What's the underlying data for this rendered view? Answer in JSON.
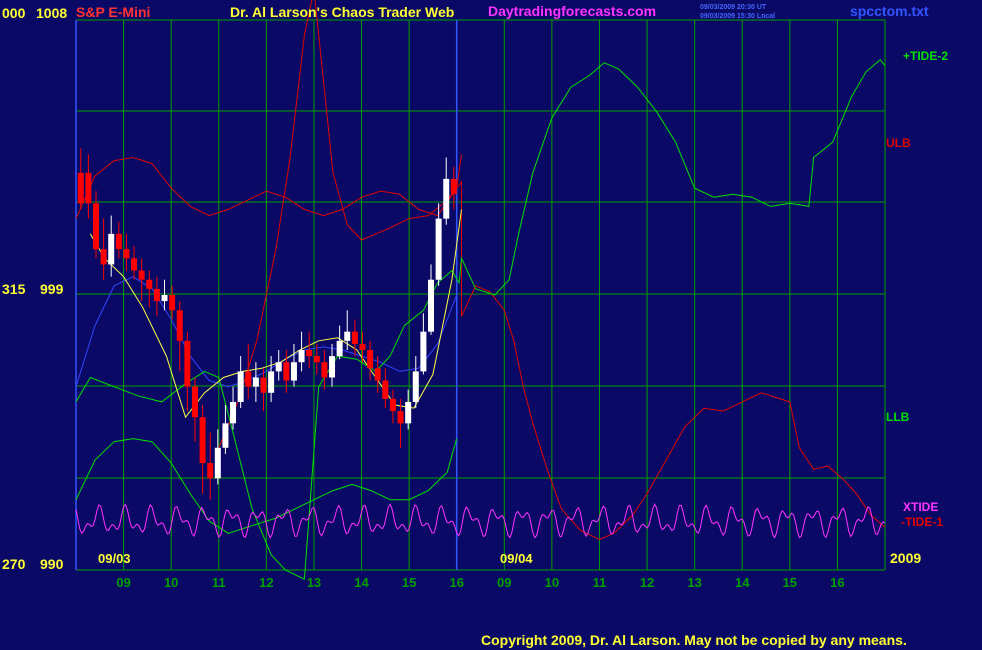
{
  "header": {
    "left_code": "000",
    "left_price": "1008",
    "symbol": "S&P E-Mini",
    "title": "Dr. Al Larson's Chaos Trader Web",
    "website": "Daytradingforecasts.com",
    "stamp_ut": "09/03/2009 20:30 UT",
    "stamp_local": "09/03/2009 15:30 Local",
    "file": "spcctom.txt"
  },
  "footer": {
    "copyright": "Copyright 2009, Dr. Al Larson. May not be copied by any means.",
    "date_left": "09/03",
    "date_mid": "09/04",
    "year": "2009"
  },
  "colors": {
    "background": "#0a0a66",
    "grid": "#00a000",
    "divider": "#3355ff",
    "price_up": "#ffffff",
    "price_down": "#ff0000",
    "tide2": "#00e000",
    "ulb": "#e00000",
    "llb": "#00e000",
    "xtide": "#ff33ff",
    "tide1": "#e00000",
    "avg": "#ffff44",
    "cycle": "#3344ff",
    "title_yellow": "#ffff33",
    "title_red": "#ff3333",
    "title_magenta": "#ff33ff"
  },
  "chart_data": {
    "type": "line",
    "title": "Dr. Al Larson's Chaos Trader Web",
    "symbol": "S&P E-Mini",
    "ylim": [
      990,
      1008
    ],
    "y_ticks": [
      {
        "code": "000",
        "price": "1008",
        "value": 1008
      },
      {
        "code": "315",
        "price": "999",
        "value": 999
      },
      {
        "code": "270",
        "price": "990",
        "value": 990
      }
    ],
    "x_ticks": [
      "09",
      "10",
      "11",
      "12",
      "13",
      "14",
      "15",
      "16",
      "09",
      "10",
      "11",
      "12",
      "13",
      "14",
      "15",
      "16"
    ],
    "x_dates": [
      "09/03",
      "09/04"
    ],
    "series_labels": [
      {
        "name": "+TIDE-2",
        "color": "#00e000"
      },
      {
        "name": "ULB",
        "color": "#e00000"
      },
      {
        "name": "LLB",
        "color": "#00e000"
      },
      {
        "name": "XTIDE",
        "color": "#ff33ff"
      },
      {
        "name": "-TIDE-1",
        "color": "#e00000"
      }
    ],
    "price_bars_start_hour": 8.1,
    "price_bars": [
      [
        1003,
        1002,
        1003.8,
        1001.8
      ],
      [
        1003,
        1002,
        1003.6,
        1001.5
      ],
      [
        1002,
        1000.5,
        1002.4,
        1000.2
      ],
      [
        1000.5,
        1000,
        1001.5,
        999.5
      ],
      [
        1000,
        1001,
        1001.6,
        999.6
      ],
      [
        1001,
        1000.5,
        1001.4,
        1000.2
      ],
      [
        1000.5,
        1000.2,
        1001,
        999.8
      ],
      [
        1000.2,
        999.8,
        1000.6,
        999.5
      ],
      [
        999.8,
        999.5,
        1000.2,
        998.8
      ],
      [
        999.5,
        999.2,
        999.8,
        998.6
      ],
      [
        999.2,
        998.8,
        999.6,
        998.3
      ],
      [
        998.8,
        999,
        999.5,
        998.5
      ],
      [
        999,
        998.5,
        999.3,
        998.2
      ],
      [
        998.5,
        997.5,
        998.8,
        996.5
      ],
      [
        997.5,
        996,
        997.8,
        995.2
      ],
      [
        996,
        995,
        996.3,
        994.2
      ],
      [
        995,
        993.5,
        995.4,
        992.5
      ],
      [
        993.5,
        993,
        994.5,
        992.3
      ],
      [
        993,
        994,
        994.6,
        992.8
      ],
      [
        994,
        994.8,
        995.4,
        993.8
      ],
      [
        994.8,
        995.5,
        996,
        994.6
      ],
      [
        995.5,
        996.5,
        997,
        995.3
      ],
      [
        996.5,
        996,
        997.4,
        995.6
      ],
      [
        996,
        996.3,
        996.8,
        995.5
      ],
      [
        996.3,
        995.8,
        996.6,
        995.2
      ],
      [
        995.8,
        996.5,
        997,
        995.5
      ],
      [
        996.5,
        996.8,
        997.2,
        996.2
      ],
      [
        996.8,
        996.2,
        997.2,
        995.8
      ],
      [
        996.2,
        996.8,
        997.4,
        996
      ],
      [
        996.8,
        997.2,
        997.8,
        996.5
      ],
      [
        997.2,
        997,
        997.8,
        996.6
      ],
      [
        997,
        996.8,
        997.4,
        996.4
      ],
      [
        996.8,
        996.3,
        997.2,
        995.9
      ],
      [
        996.3,
        997,
        997.4,
        996
      ],
      [
        997,
        997.5,
        998,
        996.9
      ],
      [
        997.5,
        997.8,
        998.5,
        997.2
      ],
      [
        997.8,
        997.4,
        998.2,
        997
      ],
      [
        997.4,
        997.2,
        997.8,
        996.8
      ],
      [
        997.2,
        996.6,
        997.5,
        996.2
      ],
      [
        996.6,
        996.2,
        997,
        995.8
      ],
      [
        996.2,
        995.6,
        996.6,
        995.3
      ],
      [
        995.6,
        995.2,
        995.9,
        994.8
      ],
      [
        995.2,
        994.8,
        995.6,
        994
      ],
      [
        994.8,
        995.5,
        995.9,
        994.6
      ],
      [
        995.5,
        996.5,
        997,
        995.3
      ],
      [
        996.5,
        997.8,
        998.4,
        996.4
      ],
      [
        997.8,
        999.5,
        1000,
        997.7
      ],
      [
        999.5,
        1001.5,
        1002,
        999.3
      ],
      [
        1001.5,
        1002.8,
        1003.5,
        1001.3
      ],
      [
        1002.8,
        1002.3,
        1003.2,
        1001.8
      ]
    ],
    "moving_average": [
      [
        8.3,
        1001
      ],
      [
        8.6,
        1000.2
      ],
      [
        9.0,
        999.6
      ],
      [
        9.4,
        998.6
      ],
      [
        9.9,
        997
      ],
      [
        10.3,
        995
      ],
      [
        10.7,
        995.8
      ],
      [
        11.1,
        996.3
      ],
      [
        11.5,
        996.5
      ],
      [
        11.9,
        996.6
      ],
      [
        12.3,
        996.8
      ],
      [
        12.7,
        997.2
      ],
      [
        13.1,
        997.5
      ],
      [
        13.5,
        997.6
      ],
      [
        13.9,
        997.2
      ],
      [
        14.3,
        996.3
      ],
      [
        14.7,
        995.4
      ],
      [
        15.1,
        995.3
      ],
      [
        15.5,
        996.4
      ],
      [
        15.9,
        999.5
      ],
      [
        16.1,
        1001.8
      ]
    ],
    "cycle": [
      [
        8.0,
        996
      ],
      [
        8.4,
        998
      ],
      [
        8.8,
        999.3
      ],
      [
        9.2,
        999.6
      ],
      [
        9.6,
        999.2
      ],
      [
        10.0,
        998.2
      ],
      [
        10.4,
        997
      ],
      [
        10.8,
        996.2
      ],
      [
        11.2,
        996
      ],
      [
        11.6,
        996.2
      ],
      [
        12.0,
        996.5
      ],
      [
        12.4,
        996.9
      ],
      [
        12.8,
        997.2
      ],
      [
        13.2,
        997.3
      ],
      [
        13.6,
        997.2
      ],
      [
        14.0,
        997
      ],
      [
        14.4,
        996.8
      ],
      [
        14.8,
        996.5
      ],
      [
        15.2,
        996.6
      ],
      [
        15.6,
        997.4
      ],
      [
        16.0,
        999
      ]
    ],
    "ulb": [
      [
        8.0,
        1001.5
      ],
      [
        8.4,
        1002.9
      ],
      [
        8.8,
        1003.4
      ],
      [
        9.2,
        1003.5
      ],
      [
        9.6,
        1003.3
      ],
      [
        10.0,
        1002.5
      ],
      [
        10.4,
        1001.9
      ],
      [
        10.8,
        1001.6
      ],
      [
        11.2,
        1001.8
      ],
      [
        11.6,
        1002.1
      ],
      [
        12.0,
        1002.4
      ],
      [
        12.4,
        1002.2
      ],
      [
        12.8,
        1001.8
      ],
      [
        13.2,
        1001.6
      ],
      [
        13.6,
        1001.8
      ],
      [
        14.0,
        1002.2
      ],
      [
        14.4,
        1002.4
      ],
      [
        14.8,
        1002.3
      ],
      [
        15.2,
        1001.8
      ],
      [
        15.6,
        1001.6
      ],
      [
        16.0,
        1002.5
      ],
      [
        16.1,
        1003.6
      ]
    ],
    "llb": [
      [
        8.0,
        992.3
      ],
      [
        8.4,
        993.6
      ],
      [
        8.8,
        994.2
      ],
      [
        9.2,
        994.3
      ],
      [
        9.6,
        994.2
      ],
      [
        10.0,
        993.5
      ],
      [
        10.4,
        992.5
      ],
      [
        10.8,
        991.6
      ],
      [
        11.2,
        991.2
      ],
      [
        11.6,
        991.4
      ],
      [
        11.8,
        991.5
      ],
      [
        12.2,
        991.7
      ],
      [
        12.6,
        992
      ],
      [
        13.0,
        992.3
      ],
      [
        13.4,
        992.6
      ],
      [
        13.8,
        992.8
      ],
      [
        14.2,
        992.6
      ],
      [
        14.6,
        992.3
      ],
      [
        15.0,
        992.3
      ],
      [
        15.4,
        992.6
      ],
      [
        15.8,
        993.2
      ],
      [
        16.0,
        994.3
      ]
    ],
    "tide2": [
      [
        8.0,
        995.5
      ],
      [
        8.3,
        996.3
      ],
      [
        8.8,
        996
      ],
      [
        9.3,
        995.7
      ],
      [
        9.8,
        995.5
      ],
      [
        10.3,
        996.1
      ],
      [
        10.7,
        996.5
      ],
      [
        11.0,
        996.3
      ],
      [
        11.3,
        994.5
      ],
      [
        11.7,
        992
      ],
      [
        12.1,
        990.5
      ],
      [
        12.4,
        990
      ],
      [
        12.8,
        989.7
      ],
      [
        13.1,
        996
      ],
      [
        13.5,
        997
      ],
      [
        13.9,
        996.9
      ],
      [
        14.3,
        996.5
      ],
      [
        14.6,
        997
      ],
      [
        14.9,
        998
      ],
      [
        15.3,
        998.5
      ],
      [
        15.6,
        999.4
      ],
      [
        15.9,
        999.8
      ],
      [
        16.05,
        999.4
      ],
      [
        16.1,
        1000.2
      ],
      [
        16.4,
        999.2
      ],
      [
        16.8,
        999
      ],
      [
        17.1,
        999.5
      ],
      [
        17.3,
        1001
      ],
      [
        17.6,
        1003
      ],
      [
        18.0,
        1004.8
      ],
      [
        18.4,
        1005.8
      ],
      [
        18.8,
        1006.2
      ],
      [
        19.1,
        1006.6
      ],
      [
        19.4,
        1006.4
      ],
      [
        19.8,
        1005.8
      ],
      [
        20.2,
        1005
      ],
      [
        20.6,
        1004
      ],
      [
        21.0,
        1002.5
      ],
      [
        21.4,
        1002.2
      ],
      [
        21.8,
        1002.3
      ],
      [
        22.2,
        1002.2
      ],
      [
        22.6,
        1001.9
      ],
      [
        23.0,
        1002
      ],
      [
        23.4,
        1001.9
      ],
      [
        23.5,
        1003.5
      ],
      [
        23.9,
        1004
      ],
      [
        24.3,
        1005.5
      ],
      [
        24.6,
        1006.3
      ],
      [
        24.9,
        1006.7
      ],
      [
        25.0,
        1006.5
      ]
    ],
    "tide1": [
      [
        11.0,
        994
      ],
      [
        11.4,
        995.5
      ],
      [
        11.8,
        997.5
      ],
      [
        12.2,
        1000.5
      ],
      [
        12.5,
        1003.5
      ],
      [
        12.8,
        1007.5
      ],
      [
        13.0,
        1009
      ],
      [
        13.2,
        1006
      ],
      [
        13.4,
        1003
      ],
      [
        13.7,
        1001.3
      ],
      [
        14.0,
        1000.8
      ],
      [
        14.3,
        1001
      ],
      [
        14.6,
        1001.2
      ],
      [
        15.0,
        1001.5
      ],
      [
        15.4,
        1001.6
      ],
      [
        15.8,
        1002.1
      ],
      [
        16.1,
        1002.7
      ],
      [
        16.1,
        998.3
      ],
      [
        16.4,
        999.3
      ],
      [
        16.7,
        999.1
      ],
      [
        17.0,
        998.5
      ],
      [
        17.2,
        997.5
      ],
      [
        17.4,
        996
      ],
      [
        17.6,
        994.8
      ],
      [
        17.9,
        993.3
      ],
      [
        18.2,
        992
      ],
      [
        18.6,
        991.3
      ],
      [
        19.0,
        991
      ],
      [
        19.3,
        991.2
      ],
      [
        19.7,
        991.8
      ],
      [
        20.0,
        992.5
      ],
      [
        20.4,
        993.6
      ],
      [
        20.8,
        994.7
      ],
      [
        21.2,
        995.3
      ],
      [
        21.6,
        995.2
      ],
      [
        22.0,
        995.5
      ],
      [
        22.4,
        995.8
      ],
      [
        22.8,
        995.6
      ],
      [
        23.0,
        995.5
      ],
      [
        23.2,
        994
      ],
      [
        23.5,
        993.3
      ],
      [
        23.8,
        993.4
      ],
      [
        24.1,
        993
      ],
      [
        24.4,
        992.5
      ],
      [
        24.7,
        991.8
      ],
      [
        25.0,
        991.4
      ]
    ],
    "xtide_base": 991.6,
    "xtide_amplitude": 0.55
  }
}
